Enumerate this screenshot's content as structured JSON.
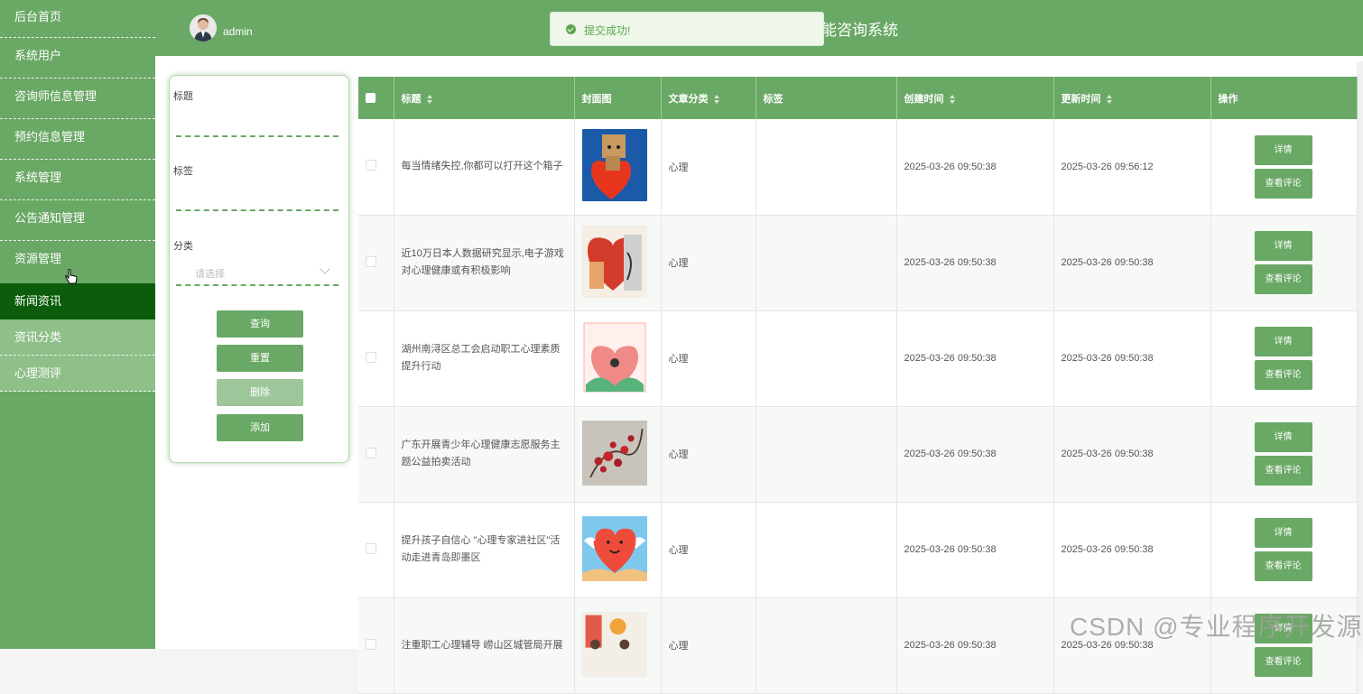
{
  "sidebar": {
    "items": [
      {
        "label": "后台首页"
      },
      {
        "label": "系统用户"
      },
      {
        "label": "咨询师信息管理"
      },
      {
        "label": "预约信息管理"
      },
      {
        "label": "系统管理"
      },
      {
        "label": "公告通知管理"
      },
      {
        "label": "资源管理"
      },
      {
        "label": "新闻资讯"
      },
      {
        "label": "资讯分类"
      },
      {
        "label": "心理测评"
      }
    ]
  },
  "header": {
    "user": "admin",
    "system_title": "能咨询系统"
  },
  "toast": {
    "message": "提交成功!"
  },
  "search": {
    "title_label": "标题",
    "tag_label": "标签",
    "category_label": "分类",
    "category_placeholder": "请选择",
    "query_button": "查询",
    "reset_button": "重置",
    "delete_button": "删除",
    "add_button": "添加"
  },
  "table": {
    "headers": {
      "title": "标题",
      "cover": "封面图",
      "category": "文章分类",
      "tags": "标签",
      "created": "创建时间",
      "updated": "更新时间",
      "actions": "操作"
    },
    "detail_label": "详情",
    "comments_label": "查看评论",
    "rows": [
      {
        "title": "每当情绪失控,你都可以打开这个箱子",
        "category": "心理",
        "tags": "",
        "created": "2025-03-26 09:50:38",
        "updated": "2025-03-26 09:56:12"
      },
      {
        "title": "近10万日本人数据研究显示,电子游戏对心理健康或有积极影响",
        "category": "心理",
        "tags": "",
        "created": "2025-03-26 09:50:38",
        "updated": "2025-03-26 09:50:38"
      },
      {
        "title": "湖州南浔区总工会启动职工心理素质提升行动",
        "category": "心理",
        "tags": "",
        "created": "2025-03-26 09:50:38",
        "updated": "2025-03-26 09:50:38"
      },
      {
        "title": "广东开展青少年心理健康志愿服务主题公益拍卖活动",
        "category": "心理",
        "tags": "",
        "created": "2025-03-26 09:50:38",
        "updated": "2025-03-26 09:50:38"
      },
      {
        "title": "提升孩子自信心 \"心理专家进社区\"活动走进青岛即墨区",
        "category": "心理",
        "tags": "",
        "created": "2025-03-26 09:50:38",
        "updated": "2025-03-26 09:50:38"
      },
      {
        "title": "注重职工心理辅导 崂山区城管局开展",
        "category": "心理",
        "tags": "",
        "created": "2025-03-26 09:50:38",
        "updated": "2025-03-26 09:50:38"
      }
    ]
  },
  "watermark": "CSDN @专业程序开发源",
  "colors": {
    "primary": "#6aa865",
    "active": "#0b5d0b",
    "sub": "#8fc08a",
    "success": "#5aa64b"
  }
}
